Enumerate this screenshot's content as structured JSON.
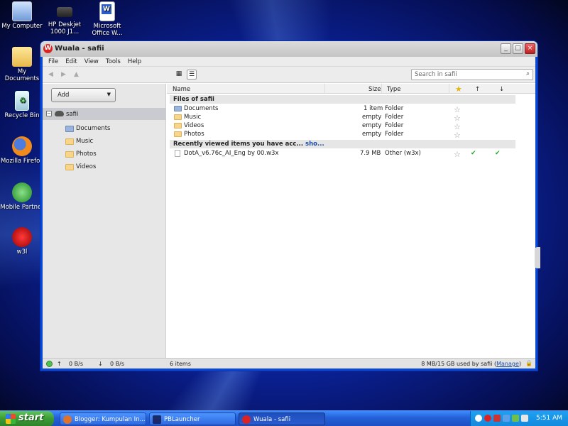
{
  "desktop": {
    "icons": [
      {
        "label": "My Computer",
        "icon": "computer-icon"
      },
      {
        "label": "HP Deskjet 1000 J1...",
        "icon": "printer-icon"
      },
      {
        "label": "Microsoft Office W...",
        "icon": "word-document-icon"
      },
      {
        "label": "My Documents",
        "icon": "folder-icon"
      },
      {
        "label": "Recycle Bin",
        "icon": "recycle-bin-icon"
      },
      {
        "label": "Mozilla Firefox",
        "icon": "firefox-icon"
      },
      {
        "label": "Mobile Partner",
        "icon": "mobile-partner-icon"
      },
      {
        "label": "w3l",
        "icon": "w3l-icon"
      }
    ]
  },
  "window": {
    "title": "Wuala - safii",
    "logo_letter": "W",
    "buttons": {
      "minimize": "_",
      "maximize": "□",
      "close": "×"
    }
  },
  "menu": [
    "File",
    "Edit",
    "View",
    "Tools",
    "Help"
  ],
  "toolbar": {
    "back_icon": "◀",
    "forward_icon": "▶",
    "up_icon": "▲",
    "grid_view_icon": "▦",
    "list_view_icon": "☰",
    "search_placeholder": "Search in safii",
    "search_icon": "⌕"
  },
  "sidebar": {
    "add_label": "Add",
    "add_caret": "▼",
    "root": {
      "label": "safii",
      "expander": "−"
    },
    "items": [
      "Documents",
      "Music",
      "Photos",
      "Videos"
    ]
  },
  "columns": {
    "name": "Name",
    "size": "Size",
    "type": "Type",
    "star": "★",
    "up": "↑",
    "down": "↓"
  },
  "groups": {
    "files_title": "Files of safii",
    "recent_title": "Recently viewed items you have acc...",
    "recent_more": " sho..."
  },
  "files": [
    {
      "name": "Documents",
      "size": "1 item",
      "type": "Folder",
      "starred": false
    },
    {
      "name": "Music",
      "size": "empty",
      "type": "Folder",
      "starred": false
    },
    {
      "name": "Videos",
      "size": "empty",
      "type": "Folder",
      "starred": false
    },
    {
      "name": "Photos",
      "size": "empty",
      "type": "Folder",
      "starred": false
    }
  ],
  "recent": [
    {
      "name": "DotA_v6.76c_AI_Eng by 00.w3x",
      "size": "7.9 MB",
      "type": "Other (w3x)",
      "uploaded": "✔",
      "downloaded": "✔"
    }
  ],
  "star_icon": "☆",
  "status": {
    "upload_arrow": "↑",
    "download_arrow": "↓",
    "upload_rate": "0 B/s",
    "download_rate": "0 B/s",
    "item_count": "6 items",
    "usage_text": "8 MB/15 GB used by safii (",
    "manage_link": "Manage",
    "usage_suffix": ")",
    "lock_icon": "🔒"
  },
  "taskbar": {
    "start_label": "start",
    "tasks": [
      {
        "label": "Blogger: Kumpulan In...",
        "icon_color": "#e0722a",
        "active": false
      },
      {
        "label": "PBLauncher",
        "icon_color": "#1b2a6b",
        "active": false
      },
      {
        "label": "Wuala - safii",
        "icon_color": "#d22",
        "active": true
      }
    ],
    "clock": "5:51 AM"
  },
  "colors": {
    "accent_blue": "#1f4ea6",
    "check_green": "#29a629",
    "wuala_red": "#dd2222"
  }
}
